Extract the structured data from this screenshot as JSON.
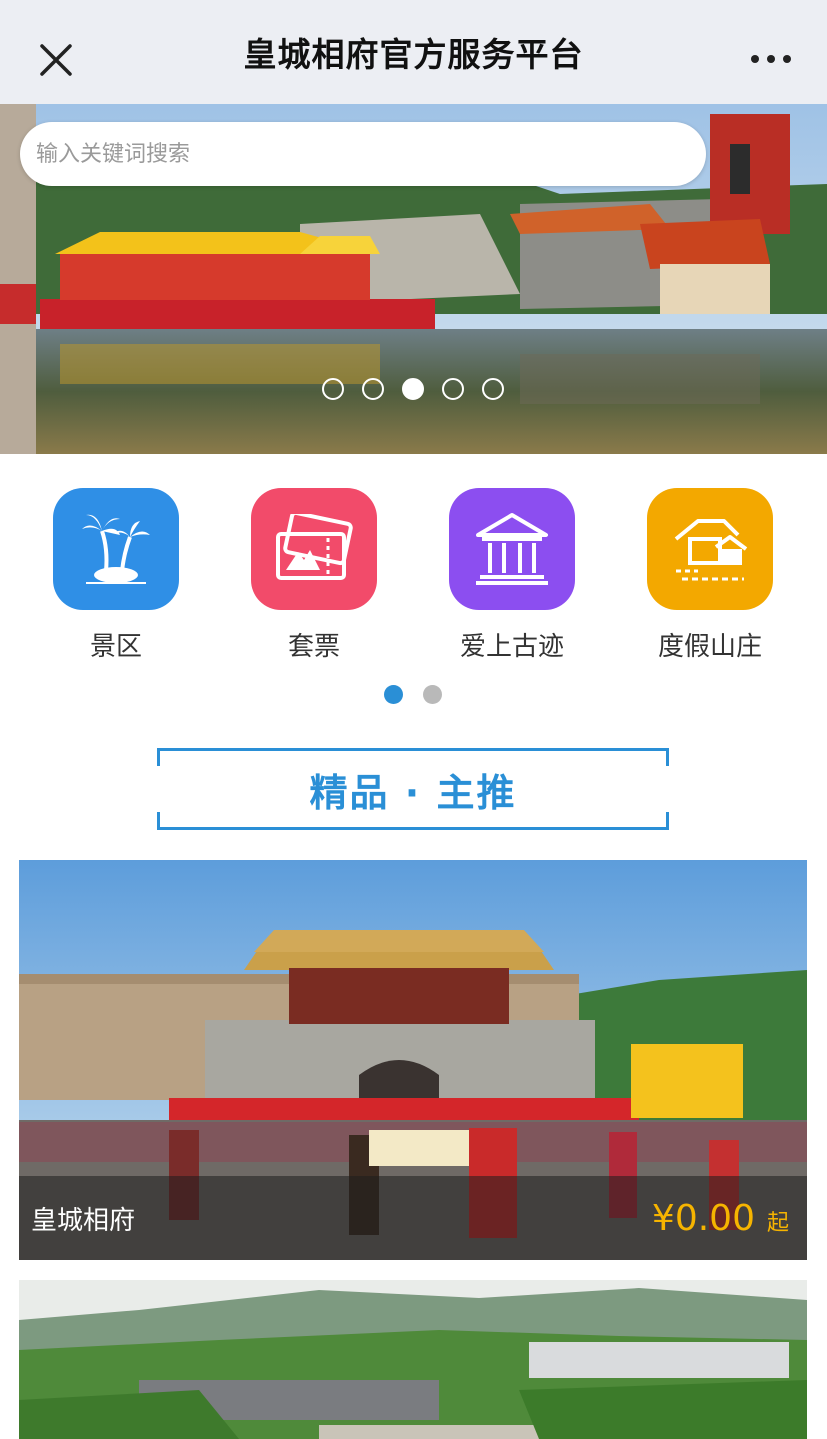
{
  "header": {
    "title": "皇城相府官方服务平台",
    "close_icon": "close-icon",
    "more_icon": "more-icon"
  },
  "search": {
    "placeholder": "输入关键词搜索"
  },
  "banner": {
    "slide_count": 5,
    "active_slide": 3
  },
  "categories": [
    {
      "label": "景区",
      "icon": "palm-tree-icon",
      "color": "#2f8fe6"
    },
    {
      "label": "套票",
      "icon": "ticket-icon",
      "color": "#f24b6a"
    },
    {
      "label": "爱上古迹",
      "icon": "temple-icon",
      "color": "#8c4ef0"
    },
    {
      "label": "度假山庄",
      "icon": "villa-icon",
      "color": "#f3a800"
    }
  ],
  "category_pager": {
    "page_count": 2,
    "active_page": 1
  },
  "section": {
    "title": "精品 · 主推"
  },
  "products": [
    {
      "name": "皇城相府",
      "price": "¥0.00",
      "price_suffix": "起"
    },
    {
      "name": "",
      "price": "",
      "price_suffix": ""
    }
  ],
  "colors": {
    "accent": "#2a8fd6",
    "price": "#f6b400"
  }
}
